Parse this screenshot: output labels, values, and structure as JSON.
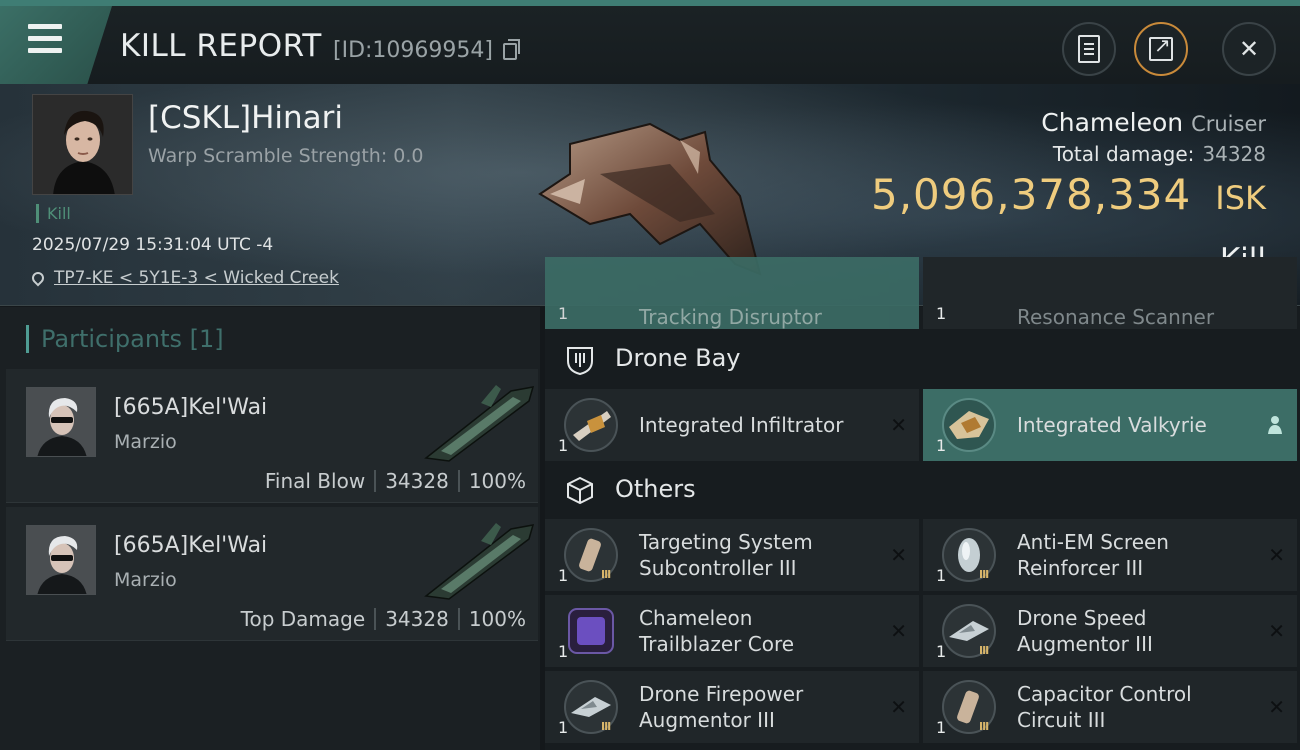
{
  "header": {
    "title": "KILL REPORT",
    "report_id": "[ID:10969954]"
  },
  "victim": {
    "name": "[CSKL]Hinari",
    "warp_scramble": "Warp Scramble Strength: 0.0",
    "tag": "Kill",
    "timestamp": "2025/07/29 15:31:04 UTC -4",
    "location": "TP7-KE < 5Y1E-3 < Wicked Creek"
  },
  "ship": {
    "name": "Chameleon",
    "class": "Cruiser",
    "total_damage_label": "Total damage:",
    "total_damage": "34328",
    "isk_value": "5,096,378,334",
    "isk_unit": "ISK",
    "result": "Kill"
  },
  "participants": {
    "header": "Participants",
    "count": "[1]",
    "items": [
      {
        "name": "[665A]Kel'Wai",
        "corp": "Marzio",
        "role": "Final Blow",
        "damage": "34328",
        "percent": "100%"
      },
      {
        "name": "[665A]Kel'Wai",
        "corp": "Marzio",
        "role": "Top Damage",
        "damage": "34328",
        "percent": "100%"
      }
    ]
  },
  "modules": {
    "partial_top": [
      {
        "name": "Tracking Disruptor",
        "qty": "1"
      },
      {
        "name": "Resonance Scanner",
        "qty": "1"
      }
    ],
    "drone_bay": {
      "title": "Drone Bay",
      "items": [
        {
          "name": "Integrated Infiltrator",
          "qty": "1"
        },
        {
          "name": "Integrated Valkyrie",
          "qty": "1"
        }
      ]
    },
    "others": {
      "title": "Others",
      "items": [
        {
          "name": "Targeting System Subcontroller III",
          "line1": "Targeting System",
          "line2": "Subcontroller III",
          "qty": "1"
        },
        {
          "name": "Anti-EM Screen Reinforcer III",
          "line1": "Anti-EM Screen",
          "line2": "Reinforcer III",
          "qty": "1"
        },
        {
          "name": "Chameleon Trailblazer Core",
          "line1": "Chameleon",
          "line2": "Trailblazer Core",
          "qty": "1"
        },
        {
          "name": "Drone Speed Augmentor III",
          "line1": "Drone Speed",
          "line2": "Augmentor III",
          "qty": "1"
        },
        {
          "name": "Drone Firepower Augmentor III",
          "line1": "Drone Firepower",
          "line2": "Augmentor III",
          "qty": "1"
        },
        {
          "name": "Capacitor Control Circuit III",
          "line1": "Capacitor Control",
          "line2": "Circuit III",
          "qty": "1"
        }
      ]
    }
  },
  "colors": {
    "accent_teal": "#3c6d66",
    "isk_gold": "#efcc7e",
    "kill_green": "#4f8f78"
  }
}
